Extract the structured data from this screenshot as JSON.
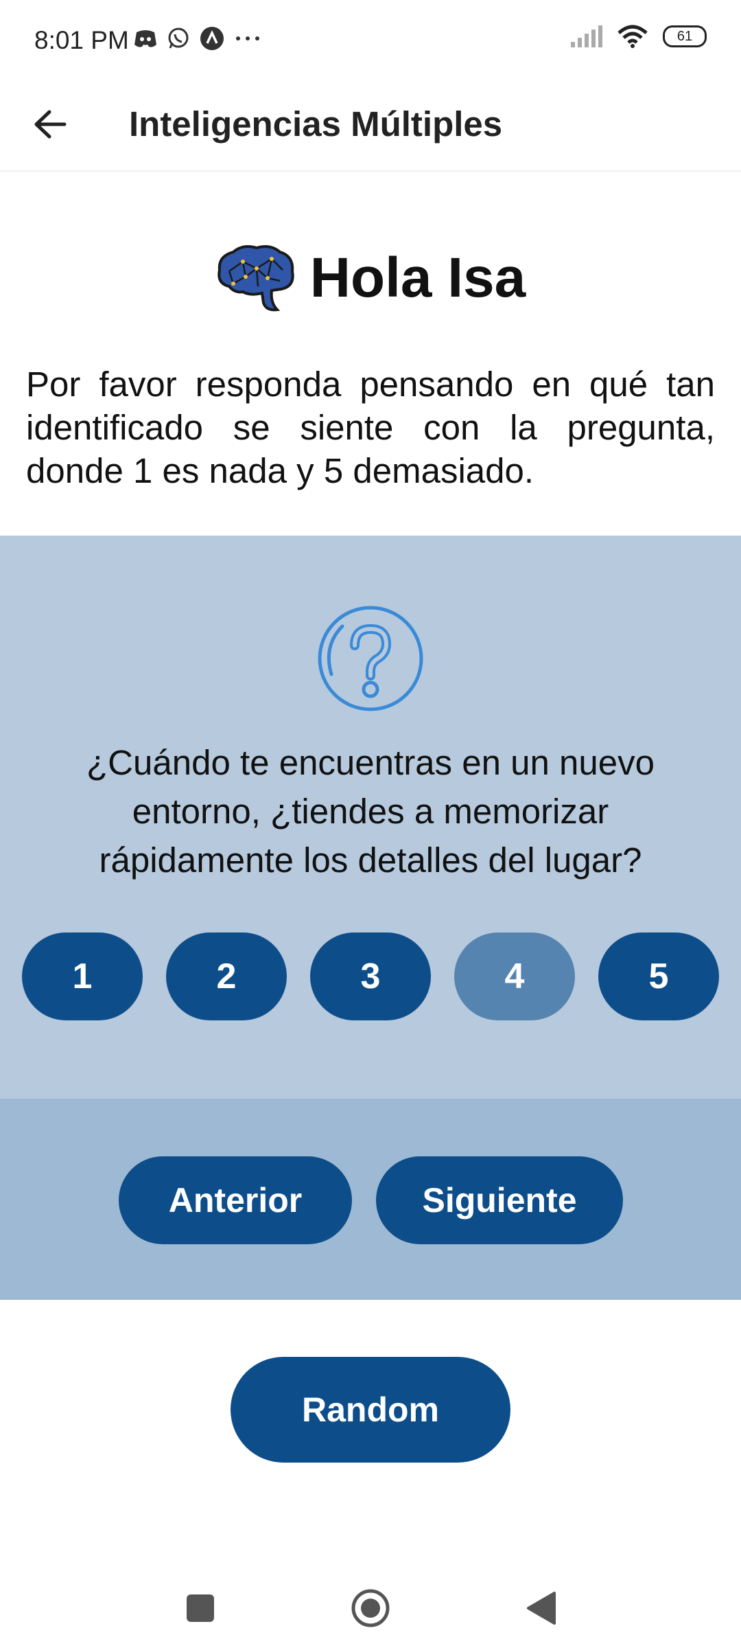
{
  "status_bar": {
    "time": "8:01 PM",
    "left_icons": [
      "discord-icon",
      "whatsapp-icon",
      "app-a-icon",
      "more-dots-icon"
    ],
    "battery": "61"
  },
  "app_bar": {
    "title": "Inteligencias Múltiples",
    "back_icon": "arrow-left-icon"
  },
  "greeting": "Hola Isa",
  "intro": "Por favor responda pensando en qué tan identificado se siente con la pregunta, donde 1 es nada y 5 demasiado.",
  "question": {
    "icon": "question-circle-icon",
    "text": "¿Cuándo te encuentras en un nuevo entorno, ¿tiendes a memorizar rápidamente los detalles del lugar?",
    "options": [
      "1",
      "2",
      "3",
      "4",
      "5"
    ],
    "selected": "4"
  },
  "nav": {
    "previous": "Anterior",
    "next": "Siguiente"
  },
  "random": "Random",
  "colors": {
    "primary": "#0d4e8a",
    "selected": "#5684b0",
    "question_bg": "#b6c9dd",
    "nav_bg": "#9eb9d4",
    "icon_blue": "#3a8ad8"
  }
}
